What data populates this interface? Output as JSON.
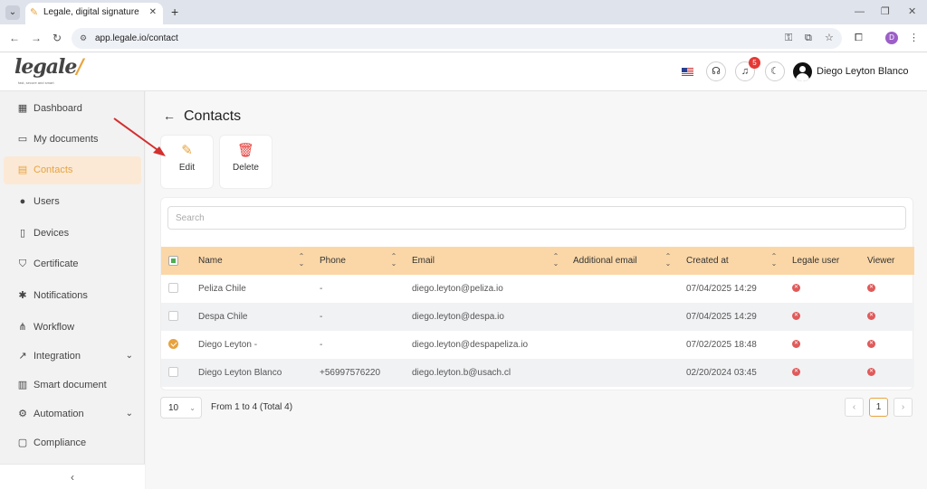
{
  "browser": {
    "tab_title": "Legale, digital signature",
    "tab_close": "✕",
    "new_tab": "+",
    "url": "app.legale.io/contact",
    "profile_initial": "D"
  },
  "header": {
    "logo_text": "legale",
    "logo_mark": "/",
    "logo_tagline": "fast, secure and smart",
    "notification_count": "5",
    "user_name": "Diego Leyton Blanco"
  },
  "sidebar": {
    "items": [
      {
        "label": "Dashboard",
        "icon": "dashboard-icon",
        "glyph": "▦"
      },
      {
        "label": "My documents",
        "icon": "folder-icon",
        "glyph": "▭"
      },
      {
        "label": "Contacts",
        "icon": "contacts-icon",
        "glyph": "▤",
        "active": true
      },
      {
        "label": "Users",
        "icon": "user-icon",
        "glyph": "●"
      },
      {
        "label": "Devices",
        "icon": "device-icon",
        "glyph": "▯"
      },
      {
        "label": "Certificate",
        "icon": "shield-icon",
        "glyph": "⛉"
      },
      {
        "label": "Notifications",
        "icon": "bell-icon",
        "glyph": "✱"
      },
      {
        "label": "Workflow",
        "icon": "workflow-icon",
        "glyph": "⋔"
      },
      {
        "label": "Integration",
        "icon": "integration-icon",
        "glyph": "↗",
        "expandable": true
      },
      {
        "label": "Smart document",
        "icon": "smart-document-icon",
        "glyph": "▥"
      },
      {
        "label": "Automation",
        "icon": "automation-icon",
        "glyph": "⚙",
        "expandable": true
      },
      {
        "label": "Compliance",
        "icon": "compliance-icon",
        "glyph": "▢"
      }
    ],
    "collapse_glyph": "‹"
  },
  "main": {
    "title": "Contacts",
    "actions": {
      "edit_label": "Edit",
      "delete_label": "Delete"
    },
    "search_placeholder": "Search",
    "columns": [
      "Name",
      "Phone",
      "Email",
      "Additional email",
      "Created at",
      "Legale user",
      "Viewer"
    ],
    "rows": [
      {
        "name": "Peliza Chile",
        "phone": "-",
        "email": "diego.leyton@peliza.io",
        "additional_email": "",
        "created_at": "07/04/2025 14:29",
        "legale_user": false,
        "viewer": false,
        "selected": false
      },
      {
        "name": "Despa Chile",
        "phone": "-",
        "email": "diego.leyton@despa.io",
        "additional_email": "",
        "created_at": "07/04/2025 14:29",
        "legale_user": false,
        "viewer": false,
        "selected": false
      },
      {
        "name": "Diego Leyton -",
        "phone": "-",
        "email": "diego.leyton@despapeliza.io",
        "additional_email": "",
        "created_at": "07/02/2025 18:48",
        "legale_user": false,
        "viewer": false,
        "selected": true
      },
      {
        "name": "Diego Leyton Blanco",
        "phone": "+56997576220",
        "email": "diego.leyton.b@usach.cl",
        "additional_email": "",
        "created_at": "02/20/2024 03:45",
        "legale_user": false,
        "viewer": false,
        "selected": false
      }
    ],
    "pagination": {
      "page_size": "10",
      "info": "From 1 to 4 (Total 4)",
      "current_page": "1",
      "prev": "‹",
      "next": "›"
    }
  },
  "colors": {
    "accent": "#e8a33d",
    "table_header": "#fbd7a7",
    "active_nav_bg": "#fbe9d6",
    "delete_red": "#e53935",
    "annotation_arrow": "#d32f2f"
  }
}
